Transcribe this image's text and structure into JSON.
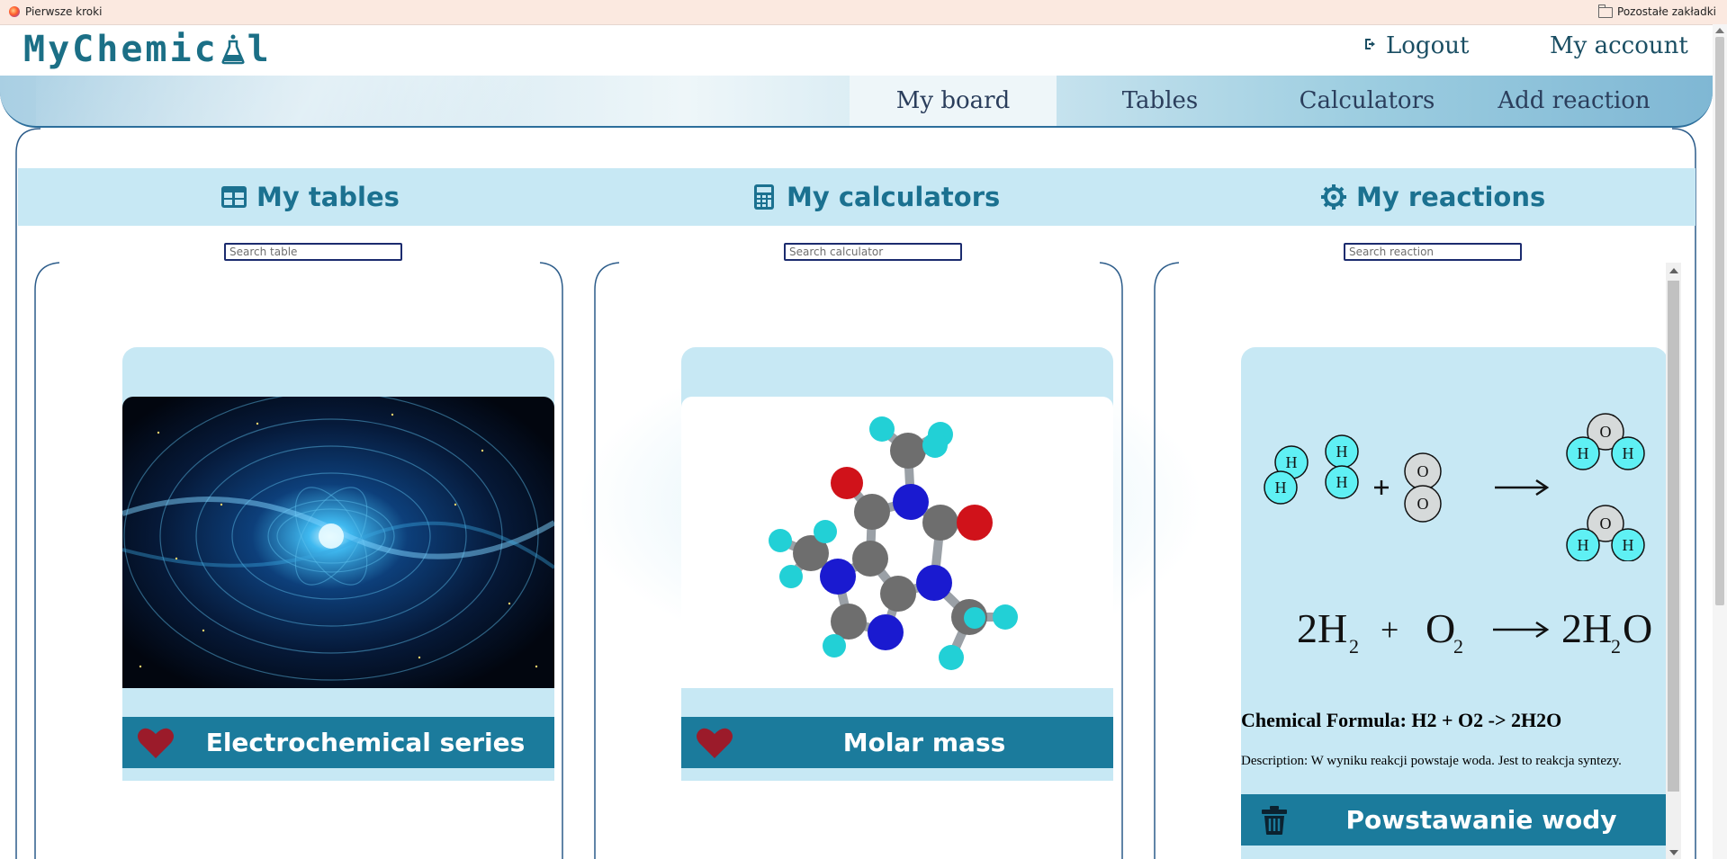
{
  "bookmarks": {
    "left_label": "Pierwsze kroki",
    "right_label": "Pozostałe zakładki"
  },
  "header": {
    "logo_text": "MyChemical",
    "logout_label": "Logout",
    "account_label": "My account"
  },
  "nav": {
    "items": [
      {
        "label": "My board",
        "active": true
      },
      {
        "label": "Tables",
        "active": false
      },
      {
        "label": "Calculators",
        "active": false
      },
      {
        "label": "Add reaction",
        "active": false
      }
    ]
  },
  "sections": {
    "tables": {
      "title": "My tables",
      "search_placeholder": "Search table"
    },
    "calculators": {
      "title": "My calculators",
      "search_placeholder": "Search calculator"
    },
    "reactions": {
      "title": "My reactions",
      "search_placeholder": "Search reaction"
    }
  },
  "cards": {
    "table_card": {
      "label": "Electrochemical series"
    },
    "calculator_card": {
      "label": "Molar mass"
    },
    "reaction_card": {
      "equation": {
        "lhs1": "2H",
        "sub1": "2",
        "plus": "+",
        "lhs2": "O",
        "sub2": "2",
        "rhs_a": "2H",
        "sub3": "2",
        "rhs_b": "O"
      },
      "formula": "Chemical Formula: H2 + O2 -> 2H2O",
      "description": "Description: W wyniku reakcji powstaje woda. Jest to reakcja syntezy.",
      "label": "Powstawanie wody",
      "atoms": {
        "h": "H",
        "o": "O"
      }
    }
  },
  "colors": {
    "primary": "#1b7b9c",
    "section_bg": "#c7e8f4",
    "heart": "#9b1b2a",
    "title_text": "#1b7190"
  }
}
